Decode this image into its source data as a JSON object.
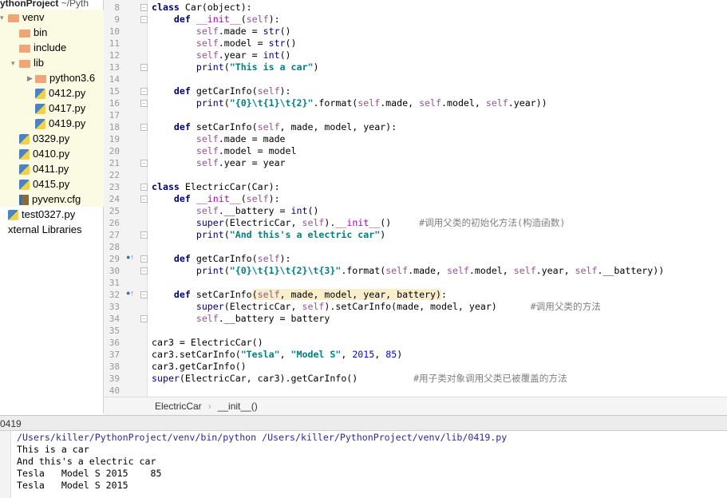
{
  "project": {
    "name": "ythonProject",
    "path": "~/Pyth"
  },
  "tree": [
    {
      "label": "venv",
      "icon": "folder",
      "indent": 0,
      "arrow": "down",
      "yellow": true
    },
    {
      "label": "bin",
      "icon": "folder",
      "indent": 1,
      "arrow": "",
      "yellow": true
    },
    {
      "label": "include",
      "icon": "folder",
      "indent": 1,
      "arrow": "",
      "yellow": true
    },
    {
      "label": "lib",
      "icon": "folder",
      "indent": 1,
      "arrow": "down",
      "yellow": true
    },
    {
      "label": "python3.6",
      "icon": "folder",
      "indent": 2,
      "arrow": "right",
      "yellow": true
    },
    {
      "label": "0412.py",
      "icon": "python-file",
      "indent": 2,
      "arrow": "",
      "yellow": true
    },
    {
      "label": "0417.py",
      "icon": "python-file",
      "indent": 2,
      "arrow": "",
      "yellow": true
    },
    {
      "label": "0419.py",
      "icon": "python-file",
      "indent": 2,
      "arrow": "",
      "yellow": true
    },
    {
      "label": "0329.py",
      "icon": "python-file",
      "indent": 1,
      "arrow": "",
      "yellow": true
    },
    {
      "label": "0410.py",
      "icon": "python-file",
      "indent": 1,
      "arrow": "",
      "yellow": true
    },
    {
      "label": "0411.py",
      "icon": "python-file",
      "indent": 1,
      "arrow": "",
      "yellow": true
    },
    {
      "label": "0415.py",
      "icon": "python-file",
      "indent": 1,
      "arrow": "",
      "yellow": true
    },
    {
      "label": "pyvenv.cfg",
      "icon": "config-file",
      "indent": 1,
      "arrow": "",
      "yellow": true
    },
    {
      "label": "test0327.py",
      "icon": "python-file",
      "indent": 0,
      "arrow": "",
      "yellow": false
    },
    {
      "label": "xternal Libraries",
      "icon": "",
      "indent": 0,
      "arrow": "",
      "yellow": false
    }
  ],
  "code": [
    {
      "n": "8",
      "t": [
        [
          "kw",
          "class "
        ],
        [
          "",
          "Car(object):"
        ]
      ]
    },
    {
      "n": "9",
      "t": [
        [
          "",
          "    "
        ],
        [
          "kw",
          "def "
        ],
        [
          "mg",
          "__init__"
        ],
        [
          "",
          "("
        ],
        [
          "self",
          "self"
        ],
        [
          "",
          "):"
        ]
      ]
    },
    {
      "n": "10",
      "t": [
        [
          "",
          "        "
        ],
        [
          "self",
          "self"
        ],
        [
          "",
          ".made = "
        ],
        [
          "bi",
          "str"
        ],
        [
          "",
          "()"
        ]
      ]
    },
    {
      "n": "11",
      "t": [
        [
          "",
          "        "
        ],
        [
          "self",
          "self"
        ],
        [
          "",
          ".model = "
        ],
        [
          "bi",
          "str"
        ],
        [
          "",
          "()"
        ]
      ]
    },
    {
      "n": "12",
      "t": [
        [
          "",
          "        "
        ],
        [
          "self",
          "self"
        ],
        [
          "",
          ".year = "
        ],
        [
          "bi",
          "int"
        ],
        [
          "",
          "()"
        ]
      ]
    },
    {
      "n": "13",
      "t": [
        [
          "",
          "        "
        ],
        [
          "bi",
          "print"
        ],
        [
          "",
          "("
        ],
        [
          "str",
          "\"This is a car\""
        ],
        [
          "",
          ")"
        ]
      ]
    },
    {
      "n": "14",
      "t": []
    },
    {
      "n": "15",
      "t": [
        [
          "",
          "    "
        ],
        [
          "kw",
          "def "
        ],
        [
          "",
          "getCarInfo("
        ],
        [
          "self",
          "self"
        ],
        [
          "",
          "):"
        ]
      ]
    },
    {
      "n": "16",
      "t": [
        [
          "",
          "        "
        ],
        [
          "bi",
          "print"
        ],
        [
          "",
          "("
        ],
        [
          "str",
          "\"{0}\\t{1}\\t{2}\""
        ],
        [
          "",
          ".format("
        ],
        [
          "self",
          "self"
        ],
        [
          "",
          ".made, "
        ],
        [
          "self",
          "self"
        ],
        [
          "",
          ".model, "
        ],
        [
          "self",
          "self"
        ],
        [
          "",
          ".year))"
        ]
      ]
    },
    {
      "n": "17",
      "t": []
    },
    {
      "n": "18",
      "t": [
        [
          "",
          "    "
        ],
        [
          "kw",
          "def "
        ],
        [
          "",
          "setCarInfo("
        ],
        [
          "self",
          "self"
        ],
        [
          "",
          ", made, model, year):"
        ]
      ]
    },
    {
      "n": "19",
      "t": [
        [
          "",
          "        "
        ],
        [
          "self",
          "self"
        ],
        [
          "",
          ".made = made"
        ]
      ]
    },
    {
      "n": "20",
      "t": [
        [
          "",
          "        "
        ],
        [
          "self",
          "self"
        ],
        [
          "",
          ".model = model"
        ]
      ]
    },
    {
      "n": "21",
      "t": [
        [
          "",
          "        "
        ],
        [
          "self",
          "self"
        ],
        [
          "",
          ".year = year"
        ]
      ]
    },
    {
      "n": "22",
      "t": []
    },
    {
      "n": "23",
      "t": [
        [
          "kw",
          "class "
        ],
        [
          "",
          "ElectricCar(Car):"
        ]
      ]
    },
    {
      "n": "24",
      "t": [
        [
          "",
          "    "
        ],
        [
          "kw",
          "def "
        ],
        [
          "mg",
          "__init__"
        ],
        [
          "",
          "("
        ],
        [
          "self",
          "self"
        ],
        [
          "",
          "):"
        ]
      ]
    },
    {
      "n": "25",
      "t": [
        [
          "",
          "        "
        ],
        [
          "self",
          "self"
        ],
        [
          "",
          ".__battery = "
        ],
        [
          "bi",
          "int"
        ],
        [
          "",
          "()"
        ]
      ]
    },
    {
      "n": "26",
      "t": [
        [
          "",
          "        "
        ],
        [
          "bi",
          "super"
        ],
        [
          "",
          "(ElectricCar, "
        ],
        [
          "self",
          "self"
        ],
        [
          "",
          ")."
        ],
        [
          "mg",
          "__init__"
        ],
        [
          "",
          "()     "
        ],
        [
          "cm",
          "#调用父类的初始化方法(构造函数)"
        ]
      ]
    },
    {
      "n": "27",
      "t": [
        [
          "",
          "        "
        ],
        [
          "bi",
          "print"
        ],
        [
          "",
          "("
        ],
        [
          "str",
          "\"And this's a electric car\""
        ],
        [
          "",
          ")"
        ]
      ]
    },
    {
      "n": "28",
      "t": []
    },
    {
      "n": "29",
      "t": [
        [
          "",
          "    "
        ],
        [
          "kw",
          "def "
        ],
        [
          "",
          "getCarInfo("
        ],
        [
          "self",
          "self"
        ],
        [
          "",
          "):"
        ]
      ]
    },
    {
      "n": "30",
      "t": [
        [
          "",
          "        "
        ],
        [
          "bi",
          "print"
        ],
        [
          "",
          "("
        ],
        [
          "str",
          "\"{0}\\t{1}\\t{2}\\t{3}\""
        ],
        [
          "",
          ".format("
        ],
        [
          "self",
          "self"
        ],
        [
          "",
          ".made, "
        ],
        [
          "self",
          "self"
        ],
        [
          "",
          ".model, "
        ],
        [
          "self",
          "self"
        ],
        [
          "",
          ".year, "
        ],
        [
          "self",
          "self"
        ],
        [
          "",
          ".__battery))"
        ]
      ]
    },
    {
      "n": "31",
      "t": []
    },
    {
      "n": "32",
      "t": [
        [
          "",
          "    "
        ],
        [
          "kw",
          "def "
        ],
        [
          "",
          "setCarInfo"
        ],
        [
          "prm",
          "("
        ],
        [
          "prm self",
          "self"
        ],
        [
          "prm",
          ", made, model, year, battery)"
        ],
        [
          "",
          ":"
        ]
      ]
    },
    {
      "n": "33",
      "t": [
        [
          "",
          "        "
        ],
        [
          "bi",
          "super"
        ],
        [
          "",
          "(ElectricCar, "
        ],
        [
          "self",
          "self"
        ],
        [
          "",
          ").setCarInfo(made, model, year)      "
        ],
        [
          "cm",
          "#调用父类的方法"
        ]
      ]
    },
    {
      "n": "34",
      "t": [
        [
          "",
          "        "
        ],
        [
          "self",
          "self"
        ],
        [
          "",
          ".__battery = battery"
        ]
      ]
    },
    {
      "n": "35",
      "t": []
    },
    {
      "n": "36",
      "t": [
        [
          "",
          "car3 = ElectricCar()"
        ]
      ]
    },
    {
      "n": "37",
      "t": [
        [
          "",
          "car3.setCarInfo("
        ],
        [
          "str",
          "\"Tesla\""
        ],
        [
          "",
          ", "
        ],
        [
          "str",
          "\"Model S\""
        ],
        [
          "",
          ", "
        ],
        [
          "num",
          "2015"
        ],
        [
          "",
          ", "
        ],
        [
          "num",
          "85"
        ],
        [
          "",
          ")"
        ]
      ]
    },
    {
      "n": "38",
      "t": [
        [
          "",
          "car3.getCarInfo()"
        ]
      ]
    },
    {
      "n": "39",
      "t": [
        [
          "bi",
          "super"
        ],
        [
          "",
          "(ElectricCar, car3).getCarInfo()          "
        ],
        [
          "cm",
          "#用子类对象调用父类已被覆盖的方法"
        ]
      ]
    },
    {
      "n": "40",
      "t": []
    }
  ],
  "breadcrumb": [
    "ElectricCar",
    "__init__()"
  ],
  "run": {
    "tab": "0419",
    "output": [
      "/Users/killer/PythonProject/venv/bin/python /Users/killer/PythonProject/venv/lib/0419.py",
      "This is a car",
      "And this's a electric car",
      "Tesla\tModel S 2015\t85",
      "Tesla\tModel S 2015"
    ]
  }
}
